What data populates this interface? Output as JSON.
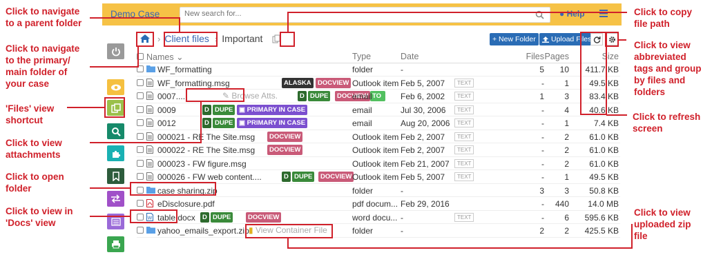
{
  "header": {
    "case_name": "Demo Case",
    "search_placeholder": "New search for...",
    "help_label": "Help"
  },
  "breadcrumb": {
    "parent": "Client files",
    "current": "Important"
  },
  "toolbar": {
    "new_folder": "+ New Folder",
    "upload_files": "Upload Files"
  },
  "columns": {
    "name": "Names",
    "type": "Type",
    "date": "Date",
    "files": "Files",
    "pages": "Pages",
    "size": "Size"
  },
  "rows": [
    {
      "name": "WF_formatting",
      "type": "folder",
      "date": "-",
      "files": "5",
      "pages": "10",
      "size": "411.7 KB"
    },
    {
      "name": "WF_formatting.msg",
      "type": "Outlook item",
      "date": "Feb 5, 2007",
      "files": "-",
      "pages": "1",
      "size": "49.5 KB"
    },
    {
      "name": "0007....",
      "type": "email",
      "date": "Feb 6, 2002",
      "files": "1",
      "pages": "3",
      "size": "83.4 KB"
    },
    {
      "name": "0009",
      "type": "email",
      "date": "Jul 30, 2006",
      "files": "-",
      "pages": "4",
      "size": "40.6 KB"
    },
    {
      "name": "0012",
      "type": "email",
      "date": "Aug 20, 2006",
      "files": "-",
      "pages": "1",
      "size": "7.4 KB"
    },
    {
      "name": "000021 - RE  The Site.msg",
      "type": "Outlook item",
      "date": "Feb 2, 2007",
      "files": "-",
      "pages": "2",
      "size": "61.0 KB"
    },
    {
      "name": "000022 - RE  The Site.msg",
      "type": "Outlook item",
      "date": "Feb 2, 2007",
      "files": "-",
      "pages": "2",
      "size": "61.0 KB"
    },
    {
      "name": "000023 - FW  figure.msg",
      "type": "Outlook item",
      "date": "Feb 21, 2007",
      "files": "-",
      "pages": "2",
      "size": "61.0 KB"
    },
    {
      "name": "000026 - FW  web content....",
      "type": "Outlook item",
      "date": "Feb 5, 2007",
      "files": "-",
      "pages": "1",
      "size": "49.5 KB"
    },
    {
      "name": "case sharing.zip",
      "type": "folder",
      "date": "-",
      "files": "3",
      "pages": "3",
      "size": "50.8 KB"
    },
    {
      "name": "eDisclosure.pdf",
      "type": "pdf docum...",
      "date": "Feb 29, 2016",
      "files": "-",
      "pages": "440",
      "size": "14.0 MB"
    },
    {
      "name": "table.docx",
      "type": "word docu...",
      "date": "-",
      "files": "-",
      "pages": "6",
      "size": "595.6 KB"
    },
    {
      "name": "yahoo_emails_export.zip",
      "type": "folder",
      "date": "-",
      "files": "2",
      "pages": "2",
      "size": "425.5 KB"
    }
  ],
  "tags": {
    "alaska": "ALASKA",
    "docview": "DOCVIEW",
    "d": "D",
    "dupe": "DUPE",
    "primary": "PRIMARY IN CASE",
    "to": "TO",
    "text": "TEXT"
  },
  "row_actions": {
    "browse_atts": "Browse Atts.",
    "view_container": "View Container File"
  },
  "annotations": {
    "parent_folder": "Click to navigate\nto a parent folder",
    "primary_folder": "Click to navigate\nto the primary/\nmain folder of\nyour case",
    "files_view": "'Files' view\nshortcut",
    "view_attachments": "Click to view\nattachments",
    "open_folder": "Click to open\nfolder",
    "docs_view": "Click to view in\n'Docs' view",
    "copy_path": "Click to copy\nfile path",
    "abbreviated_tags": "Click to view\nabbreviated\ntags and group\nby files and\nfolders",
    "refresh": "Click to refresh\nscreen",
    "zip_file": "Click to view\nuploaded zip\nfile"
  },
  "colors": {
    "topbar": "#f6c246",
    "accent_blue": "#2a6cb5",
    "annotation_red": "#d0202a",
    "docview_tag": "#c95a78",
    "dupe_tag": "#3a8a3a",
    "primary_tag": "#7b4fcf",
    "alaska_tag": "#333333"
  }
}
